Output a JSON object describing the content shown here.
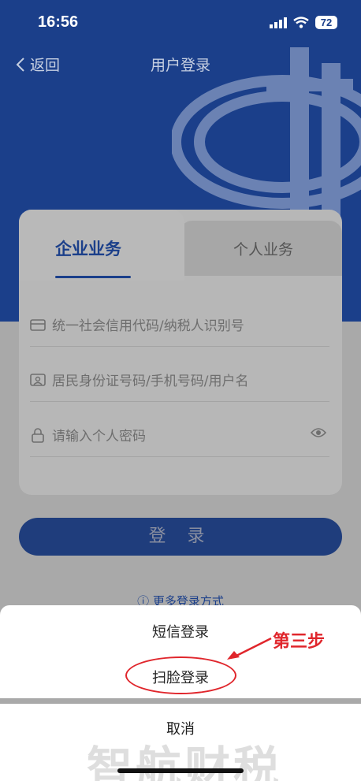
{
  "status": {
    "time": "16:56",
    "battery": "72"
  },
  "nav": {
    "back_label": "返回",
    "title": "用户登录"
  },
  "tabs": {
    "enterprise": "企业业务",
    "personal": "个人业务"
  },
  "fields": {
    "credit_code": {
      "placeholder": "统一社会信用代码/纳税人识别号"
    },
    "id_number": {
      "placeholder": "居民身份证号码/手机号码/用户名"
    },
    "password": {
      "placeholder": "请输入个人密码"
    }
  },
  "login_button": "登 录",
  "more_login": "ⓘ 更多登录方式",
  "action_sheet": {
    "sms_login": "短信登录",
    "face_login": "扫脸登录",
    "cancel": "取消"
  },
  "annotation": "第三步",
  "watermark": "智航财税",
  "colors": {
    "primary": "#1b3f8a",
    "annotation": "#e0262c"
  }
}
